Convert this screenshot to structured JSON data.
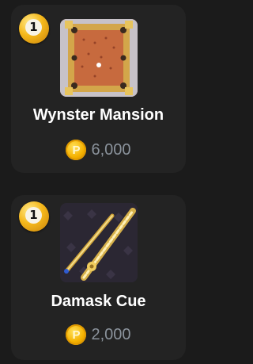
{
  "items": [
    {
      "rank_badge": "1",
      "name": "Wynster Mansion",
      "currency_symbol": "P",
      "price": "6,000",
      "thumbnail_icon": "table-icon"
    },
    {
      "rank_badge": "1",
      "name": "Damask Cue",
      "currency_symbol": "P",
      "price": "2,000",
      "thumbnail_icon": "cue-icon"
    }
  ],
  "colors": {
    "background": "#1b1b1b",
    "card": "#232323",
    "coin": "#f5b200",
    "price_text": "#8b939c"
  }
}
